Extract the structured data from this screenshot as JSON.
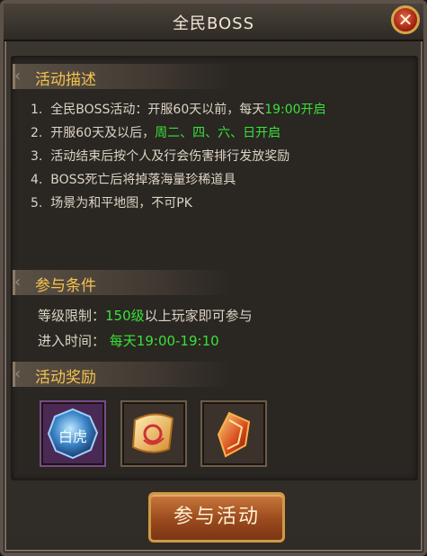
{
  "window": {
    "title": "全民BOSS",
    "close_glyph": "✕"
  },
  "description": {
    "header": "活动描述",
    "items": [
      {
        "num": "1.",
        "text": "全民BOSS活动：开服60天以前，每天",
        "highlight": "19:00开启",
        "tail": ""
      },
      {
        "num": "2.",
        "text": "开服60天及以后，",
        "highlight": "周二、四、六、日开启",
        "tail": ""
      },
      {
        "num": "3.",
        "text": "活动结束后按个人及行会伤害排行发放奖励",
        "highlight": "",
        "tail": ""
      },
      {
        "num": "4.",
        "text": "BOSS死亡后将掉落海量珍稀道具",
        "highlight": "",
        "tail": ""
      },
      {
        "num": "5.",
        "text": "场景为和平地图，不可PK",
        "highlight": "",
        "tail": ""
      }
    ]
  },
  "conditions": {
    "header": "参与条件",
    "level_label": "等级限制：",
    "level_value": "150级",
    "level_tail": "以上玩家即可参与",
    "time_label": "进入时间：",
    "time_value": "每天19:00-19:10"
  },
  "rewards": {
    "header": "活动奖励",
    "items": [
      {
        "icon": "white-tiger-orb-icon",
        "text": "白虎"
      },
      {
        "icon": "scroll-icon"
      },
      {
        "icon": "shield-icon"
      }
    ]
  },
  "action_button": {
    "label": "参与活动"
  },
  "colors": {
    "highlight": "#38e238",
    "header": "#f5c34e",
    "text": "#dcd4c5"
  }
}
